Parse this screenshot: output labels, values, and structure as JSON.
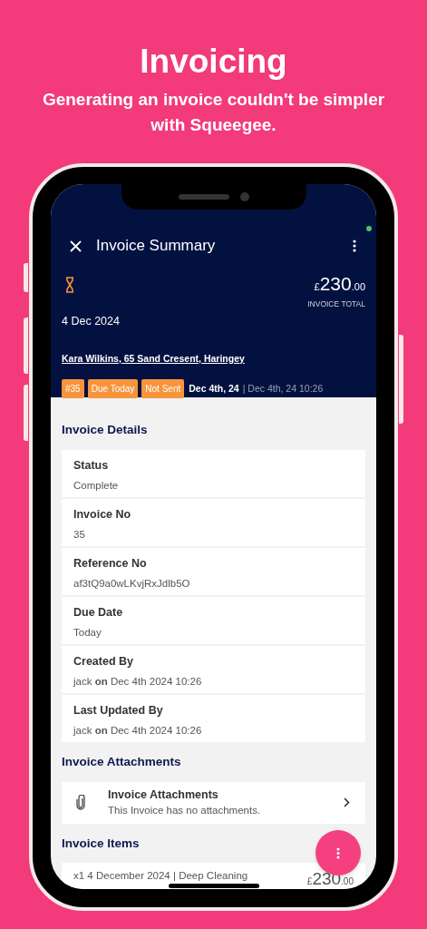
{
  "hero": {
    "title": "Invoicing",
    "subtitle": "Generating an invoice couldn't be simpler with Squeegee."
  },
  "header": {
    "title": "Invoice Summary",
    "currency": "£",
    "amount_main": "230",
    "amount_cents": ".00",
    "amount_label": "INVOICE TOTAL",
    "date": "4 Dec 2024",
    "customer": "Kara Wilkins, 65 Sand Cresent, Haringey",
    "badges": [
      "#35",
      "Due Today",
      "Not Sent"
    ],
    "date_primary": "Dec 4th, 24",
    "date_secondary": "| Dec 4th, 24 10:26"
  },
  "sections": [
    {
      "kind": "fields",
      "title": "Invoice Details",
      "fields": [
        {
          "label": "Status",
          "value": "Complete"
        },
        {
          "label": "Invoice No",
          "value": "35"
        },
        {
          "label": "Reference No",
          "value": "af3tQ9a0wLKvjRxJdlb5O"
        },
        {
          "label": "Due Date",
          "value": "Today"
        },
        {
          "label": "Created By",
          "value": "jack **on** Dec 4th 2024 10:26"
        },
        {
          "label": "Last Updated By",
          "value": "jack **on** Dec 4th 2024 10:26"
        }
      ]
    },
    {
      "kind": "attachments",
      "title": "Invoice Attachments",
      "item": {
        "title": "Invoice Attachments",
        "subtitle": "This Invoice has no attachments."
      }
    },
    {
      "kind": "items",
      "title": "Invoice Items",
      "items": [
        {
          "description": "x1 4 December 2024 | Deep Cleaning",
          "currency": "£",
          "amount_main": "230",
          "amount_cents": ".00"
        }
      ]
    }
  ]
}
